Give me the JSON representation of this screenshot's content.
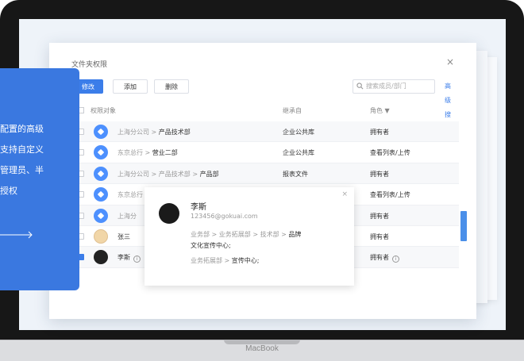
{
  "dialog": {
    "title": "文件夹权限",
    "close_label": "×",
    "toolbar": {
      "edit_label": "修改",
      "add_label": "添加",
      "delete_label": "删除",
      "search_placeholder": "搜索成员/部门",
      "advanced_search_label": "高级搜索"
    },
    "columns": {
      "target": "权限对象",
      "inherit": "继承自",
      "role": "角色 ▼"
    },
    "rows": [
      {
        "path": "上海分公司 > ",
        "name": "产品技术部",
        "inherit": "企业公共库",
        "role": "拥有者"
      },
      {
        "path": "东京总行 > ",
        "name": "营业二部",
        "inherit": "企业公共库",
        "role": "查看列表/上传"
      },
      {
        "path": "上海分公司 > 产品技术部 > ",
        "name": "产品部",
        "inherit": "报表文件",
        "role": "拥有者"
      },
      {
        "path": "东京总行",
        "name": "",
        "inherit": "",
        "role": "查看列表/上传"
      },
      {
        "path": "上海分",
        "name": "",
        "inherit": "",
        "role": "拥有者"
      },
      {
        "path": "",
        "name": "张三",
        "inherit": "",
        "role": "拥有者"
      },
      {
        "path": "",
        "name": "李斯",
        "inherit": "",
        "role": "拥有者"
      }
    ]
  },
  "popup": {
    "close_label": "×",
    "name": "李斯",
    "email": "123456@gokuai.com",
    "dept1_path": "业务部 > 业务拓展部 > 技术部 > ",
    "dept1_name": "品牌",
    "dept1_cont": "文化宣传中心;",
    "dept2_path": "业务拓展部 > ",
    "dept2_name": "宣传中心;"
  },
  "overlay": {
    "line1": "配置的高级",
    "line2": "支持自定义",
    "line3": "管理员、半",
    "line4": "授权"
  },
  "brand": "MacBook",
  "colors": {
    "accent": "#3b7de9",
    "panel": "#3a78e0",
    "bezel": "#171717"
  }
}
